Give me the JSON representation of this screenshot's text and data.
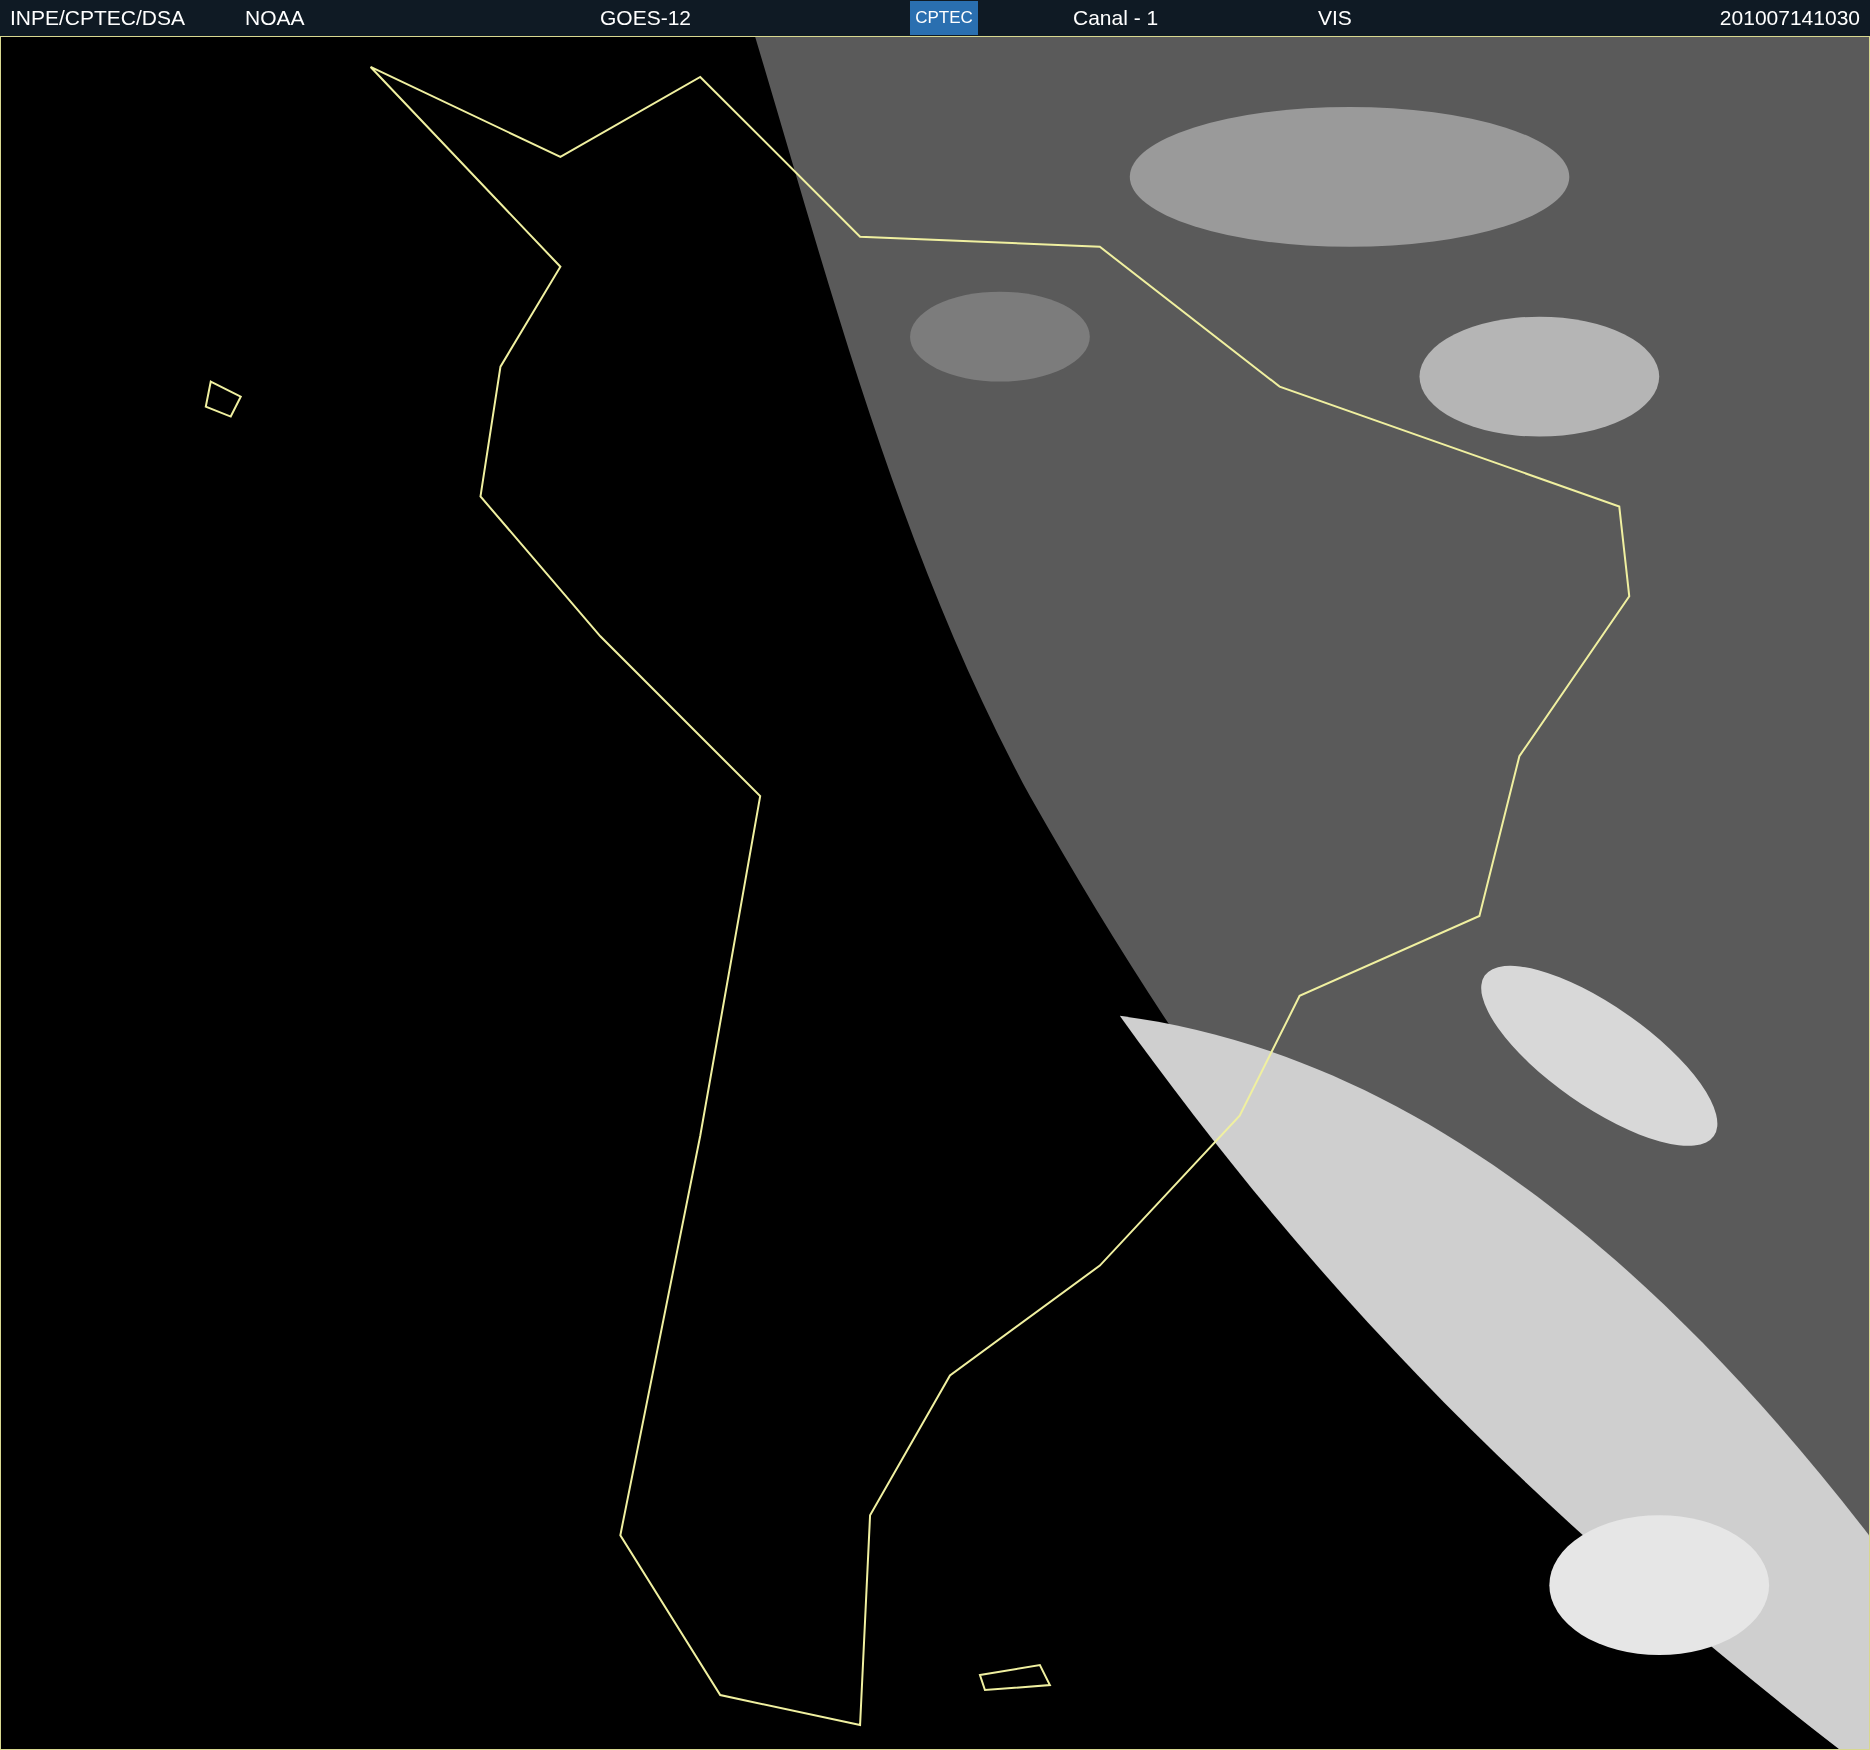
{
  "header": {
    "source": "INPE/CPTEC/DSA",
    "agency": "NOAA",
    "satellite": "GOES-12",
    "logo": "CPTEC",
    "channel": "Canal - 1",
    "band": "VIS",
    "timestamp": "201007141030"
  }
}
